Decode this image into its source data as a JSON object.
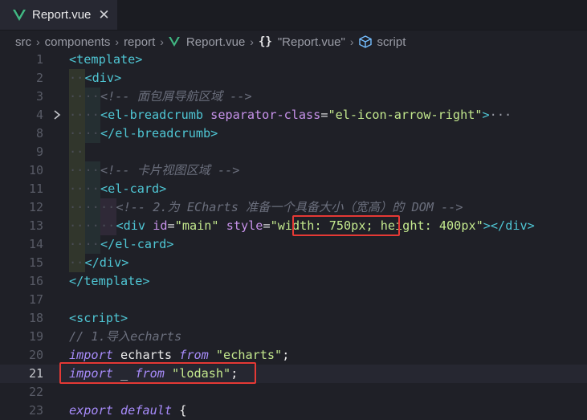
{
  "tab": {
    "title": "Report.vue",
    "close": "✕"
  },
  "breadcrumb": {
    "items": [
      "src",
      "components",
      "report",
      "Report.vue",
      "\"Report.vue\"",
      "script"
    ],
    "separator": "›",
    "braces": "{}"
  },
  "editor": {
    "current_line": "21",
    "lines": [
      {
        "num": "1",
        "segments": [
          [
            "tg",
            "<template>"
          ]
        ]
      },
      {
        "num": "2",
        "indent": [
          1
        ],
        "segments": [
          [
            "tg",
            "<div>"
          ]
        ]
      },
      {
        "num": "3",
        "indent": [
          1,
          2
        ],
        "segments": [
          [
            "cm",
            "<!-- 面包屑导航区域 -->"
          ]
        ]
      },
      {
        "num": "4",
        "indent": [
          1,
          2
        ],
        "fold": true,
        "segments": [
          [
            "tg",
            "<el-breadcrumb"
          ],
          [
            "id",
            " "
          ],
          [
            "at",
            "separator-class"
          ],
          [
            "eq",
            "="
          ],
          [
            "st",
            "\"el-icon-arrow-right\""
          ],
          [
            "tg",
            ">"
          ],
          [
            "ell",
            "···"
          ]
        ]
      },
      {
        "num": "8",
        "indent": [
          1,
          2
        ],
        "segments": [
          [
            "tg",
            "</el-breadcrumb>"
          ]
        ]
      },
      {
        "num": "9",
        "indent": [
          1
        ],
        "segments": []
      },
      {
        "num": "10",
        "indent": [
          1,
          2
        ],
        "segments": [
          [
            "cm",
            "<!-- 卡片视图区域 -->"
          ]
        ]
      },
      {
        "num": "11",
        "indent": [
          1,
          2
        ],
        "segments": [
          [
            "tg",
            "<el-card>"
          ]
        ]
      },
      {
        "num": "12",
        "indent": [
          1,
          2,
          3
        ],
        "segments": [
          [
            "cm",
            "<!-- 2.为 ECharts 准备一个具备大小（宽高）的 DOM -->"
          ]
        ]
      },
      {
        "num": "13",
        "indent": [
          1,
          2,
          3
        ],
        "segments": [
          [
            "tg",
            "<div"
          ],
          [
            "id",
            " "
          ],
          [
            "at",
            "id"
          ],
          [
            "eq",
            "="
          ],
          [
            "st",
            "\"main\""
          ],
          [
            "id",
            " "
          ],
          [
            "at",
            "style"
          ],
          [
            "eq",
            "="
          ],
          [
            "st",
            "\"width: 750px; height: 400px\""
          ],
          [
            "tg",
            "></div>"
          ]
        ]
      },
      {
        "num": "14",
        "indent": [
          1,
          2
        ],
        "segments": [
          [
            "tg",
            "</el-card>"
          ]
        ]
      },
      {
        "num": "15",
        "indent": [
          1
        ],
        "segments": [
          [
            "tg",
            "</div>"
          ]
        ]
      },
      {
        "num": "16",
        "segments": [
          [
            "tg",
            "</template>"
          ]
        ]
      },
      {
        "num": "17",
        "segments": []
      },
      {
        "num": "18",
        "segments": [
          [
            "tg",
            "<script>"
          ]
        ]
      },
      {
        "num": "19",
        "segments": [
          [
            "cm",
            "// 1.导入echarts"
          ]
        ]
      },
      {
        "num": "20",
        "segments": [
          [
            "kw",
            "import"
          ],
          [
            "id",
            " echarts "
          ],
          [
            "kw",
            "from"
          ],
          [
            "id",
            " "
          ],
          [
            "st",
            "\"echarts\""
          ],
          [
            "id",
            ";"
          ]
        ]
      },
      {
        "num": "21",
        "segments": [
          [
            "kw",
            "import"
          ],
          [
            "id",
            " _ "
          ],
          [
            "kw",
            "from"
          ],
          [
            "id",
            " "
          ],
          [
            "st",
            "\"lodash\""
          ],
          [
            "id",
            ";"
          ]
        ]
      },
      {
        "num": "22",
        "segments": []
      },
      {
        "num": "23",
        "segments": [
          [
            "kw",
            "export"
          ],
          [
            "id",
            " "
          ],
          [
            "kw",
            "default"
          ],
          [
            "id",
            " {"
          ]
        ]
      }
    ]
  },
  "colors": {
    "highlight_border": "#e53935",
    "tag": "#4fc6d4",
    "attribute": "#c792ea",
    "string": "#c3e88d",
    "comment": "#6b6f7d",
    "keyword": "#a78bfa"
  }
}
